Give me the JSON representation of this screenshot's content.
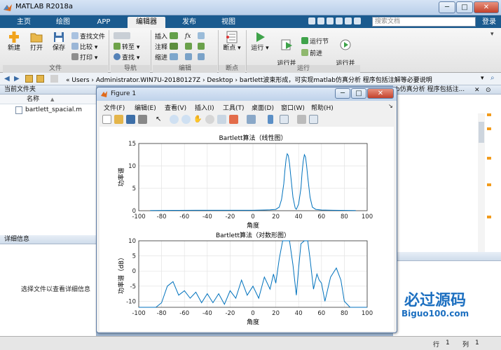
{
  "window": {
    "title": "MATLAB R2018a",
    "controls": [
      "─",
      "□",
      "✕"
    ]
  },
  "tabs": [
    {
      "label": "主页",
      "active": false
    },
    {
      "label": "绘图",
      "active": false
    },
    {
      "label": "APP",
      "active": false
    },
    {
      "label": "编辑器",
      "active": true
    },
    {
      "label": "发布",
      "active": false
    },
    {
      "label": "视图",
      "active": false
    }
  ],
  "search": {
    "placeholder": "搜索文档"
  },
  "login_label": "登录",
  "ribbon": {
    "file": {
      "new": "新建",
      "open": "打开",
      "save": "保存",
      "find_files": "查找文件",
      "compare": "比较",
      "print": "打印",
      "group": "文件"
    },
    "nav": {
      "goto": "转至",
      "find": "查找",
      "group": "导航"
    },
    "edit": {
      "insert": "插入",
      "comment": "注释",
      "indent": "缩进",
      "fx": "fx",
      "group": "编辑"
    },
    "breakpoints": {
      "label": "断点",
      "group": "断点"
    },
    "run": {
      "run": "运行",
      "run_advance": "运行并\n前进",
      "run_section": "运行节",
      "advance": "前进",
      "run_time": "运行并\n计时",
      "group": "运行"
    }
  },
  "address": {
    "path": "«  Users  ›  Administrator.WIN7U-20180127Z  ›  Desktop  ›  bartlett波束形成，可实现matlab仿真分析 程序包括注解等必要说明",
    "right_fragment": "b仿真分析 程序包括注..."
  },
  "left_panel": {
    "header": "当前文件夹",
    "column": "名称",
    "sort": "▲",
    "files": [
      {
        "name": "bartlett_spacial.m"
      }
    ],
    "details_header": "详细信息",
    "details_text": "选择文件以查看详细信息"
  },
  "status": {
    "row_label": "行",
    "row_value": "1",
    "col_label": "列",
    "col_value": "1"
  },
  "figure": {
    "title": "Figure 1",
    "menu": [
      "文件(F)",
      "编辑(E)",
      "查看(V)",
      "插入(I)",
      "工具(T)",
      "桌面(D)",
      "窗口(W)",
      "帮助(H)"
    ],
    "toolbar_icons": [
      "new-icon",
      "open-icon",
      "save-icon",
      "print-icon",
      "pointer-icon",
      "zoom-in-icon",
      "zoom-out-icon",
      "pan-icon",
      "rotate-icon",
      "data-cursor-icon",
      "brush-icon",
      "link-icon",
      "colorbar-icon",
      "legend-icon",
      "hide-plot-icon",
      "show-plot-icon"
    ]
  },
  "watermark": {
    "line1": "必过源码",
    "line2": "Biguo100.com"
  },
  "colors": {
    "ribbon_tab_bg": "#1b5b8f",
    "plot_line": "#0072bd"
  },
  "chart_data": [
    {
      "type": "line",
      "title": "Bartlett算法（线性图）",
      "xlabel": "角度",
      "ylabel": "功率谱",
      "xlim": [
        -100,
        100
      ],
      "ylim": [
        0,
        15
      ],
      "xticks": [
        -100,
        -80,
        -60,
        -40,
        -20,
        0,
        20,
        40,
        60,
        80,
        100
      ],
      "yticks": [
        0,
        5,
        10,
        15
      ],
      "grid": true,
      "series": [
        {
          "x": [
            -90,
            -70,
            -50,
            -30,
            -10,
            0,
            10,
            15,
            20,
            23,
            25,
            27,
            28,
            29,
            30,
            31,
            32,
            33,
            35,
            37,
            38,
            40,
            42,
            43,
            44,
            45,
            46,
            47,
            48,
            50,
            52,
            55,
            60,
            70,
            90
          ],
          "values": [
            0.05,
            0.08,
            0.1,
            0.1,
            0.1,
            0.1,
            0.15,
            0.2,
            0.3,
            0.8,
            2.5,
            6.0,
            9.0,
            11.5,
            12.7,
            12.3,
            10.5,
            8.0,
            3.0,
            0.6,
            0.3,
            1.5,
            5.0,
            8.5,
            11.0,
            12.5,
            12.0,
            10.0,
            7.5,
            3.0,
            0.8,
            0.3,
            0.15,
            0.1,
            0.05
          ]
        }
      ]
    },
    {
      "type": "line",
      "title": "Bartlett算法（对数形图）",
      "xlabel": "角度",
      "ylabel": "功率谱（dB）",
      "xlim": [
        -100,
        100
      ],
      "ylim": [
        -12,
        10
      ],
      "xticks": [
        -100,
        -80,
        -60,
        -40,
        -20,
        0,
        20,
        40,
        60,
        80,
        100
      ],
      "yticks": [
        -10,
        -5,
        0,
        5,
        10
      ],
      "grid": true,
      "series": [
        {
          "x": [
            -100,
            -98,
            -90,
            -85,
            -80,
            -75,
            -70,
            -65,
            -60,
            -55,
            -50,
            -45,
            -40,
            -35,
            -30,
            -25,
            -20,
            -15,
            -10,
            -5,
            0,
            5,
            10,
            15,
            18,
            20,
            23,
            26,
            28,
            30,
            32,
            35,
            38,
            40,
            42,
            45,
            48,
            50,
            53,
            56,
            58,
            60,
            63,
            68,
            73,
            77,
            80,
            85,
            90,
            95,
            100
          ],
          "values": [
            -12,
            -12,
            -12,
            -12,
            -10.5,
            -5,
            -3.5,
            -8,
            -6.5,
            -9,
            -7,
            -10.5,
            -7.5,
            -10.5,
            -7.5,
            -11,
            -6.5,
            -9,
            -3,
            -8,
            -5,
            -9,
            -2,
            -6,
            -1,
            -4,
            4,
            10,
            11,
            11,
            10,
            2,
            -8,
            1,
            9,
            11,
            10,
            4,
            -6,
            -1,
            -3,
            -4,
            -10,
            -2,
            1,
            -3,
            -10,
            -12,
            -12,
            -12,
            -12
          ]
        }
      ]
    }
  ]
}
